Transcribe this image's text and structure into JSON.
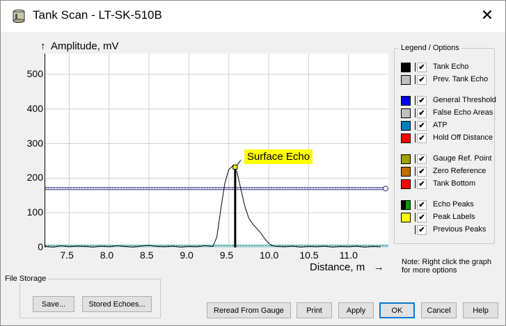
{
  "window": {
    "title": "Tank Scan - LT-SK-510B",
    "close_icon": "close-icon"
  },
  "chart_data": {
    "type": "line",
    "ylabel": "Amplitude, mV",
    "xlabel": "Distance, m",
    "x_ticks": [
      "7.5",
      "8.0",
      "8.5",
      "9.0",
      "9.5",
      "10.0",
      "10.5",
      "11.0"
    ],
    "y_ticks": [
      "0",
      "100",
      "200",
      "300",
      "400",
      "500"
    ],
    "xlim": [
      7.2,
      11.5
    ],
    "ylim": [
      0,
      560
    ],
    "grid": true,
    "series": [
      {
        "color": "#000000",
        "x": [
          7.2,
          7.3,
          7.4,
          7.5,
          7.6,
          7.7,
          7.8,
          7.9,
          8.0,
          8.1,
          8.2,
          8.3,
          8.4,
          8.5,
          8.6,
          8.7,
          8.8,
          8.9,
          9.0,
          9.1,
          9.2,
          9.3,
          9.35,
          9.4,
          9.45,
          9.5,
          9.55,
          9.6,
          9.65,
          9.7,
          9.75,
          9.8,
          9.85,
          9.9,
          9.95,
          10.0,
          10.05,
          10.1,
          10.2,
          10.3,
          10.4,
          10.5,
          10.6,
          10.7,
          10.8,
          10.9,
          11.0,
          11.1,
          11.2,
          11.3,
          11.4
        ],
        "y": [
          3,
          1,
          5,
          2,
          4,
          3,
          1,
          4,
          2,
          5,
          3,
          1,
          4,
          6,
          3,
          2,
          4,
          1,
          3,
          2,
          5,
          3,
          30,
          110,
          185,
          225,
          235,
          220,
          170,
          120,
          85,
          68,
          55,
          42,
          25,
          12,
          5,
          3,
          2,
          4,
          1,
          3,
          2,
          4,
          1,
          3,
          2,
          4,
          1,
          3,
          2
        ]
      }
    ],
    "thresholds": {
      "general_threshold": 170,
      "false_echo_baseline": 5
    },
    "peak": {
      "x": 9.58,
      "y": 232,
      "label": "Surface Echo"
    }
  },
  "legend": {
    "title": "Legend / Options",
    "items": [
      {
        "label": "Tank Echo",
        "color": "#000000",
        "checked": true
      },
      {
        "label": "Prev. Tank Echo",
        "color": "#c0c0c0",
        "checked": true
      },
      {
        "label": "General Threshold",
        "color": "#0000ff",
        "checked": true
      },
      {
        "label": "False Echo Areas",
        "color": "#c0c0c0",
        "checked": true
      },
      {
        "label": "ATP",
        "color": "#0080c0",
        "checked": true
      },
      {
        "label": "Hold Off Distance",
        "color": "#ff0000",
        "checked": true
      },
      {
        "label": "Gauge Ref. Point",
        "color": "#a0a000",
        "checked": true
      },
      {
        "label": "Zero Reference",
        "color": "#c07000",
        "checked": true
      },
      {
        "label": "Tank Bottom",
        "color": "#ff0000",
        "checked": true
      },
      {
        "label": "Echo Peaks",
        "color": "#000000",
        "color2": "#00a000",
        "checked": true
      },
      {
        "label": "Peak Labels",
        "color": "#ffff00",
        "checked": true
      },
      {
        "label": "Previous Peaks",
        "color": "",
        "checked": true
      }
    ]
  },
  "note": "Note: Right click the graph for more options",
  "file_storage": {
    "title": "File Storage",
    "save_label": "Save...",
    "stored_label": "Stored Echoes..."
  },
  "buttons": {
    "reread": "Reread From Gauge",
    "print": "Print",
    "apply": "Apply",
    "ok": "OK",
    "cancel": "Cancel",
    "help": "Help"
  }
}
